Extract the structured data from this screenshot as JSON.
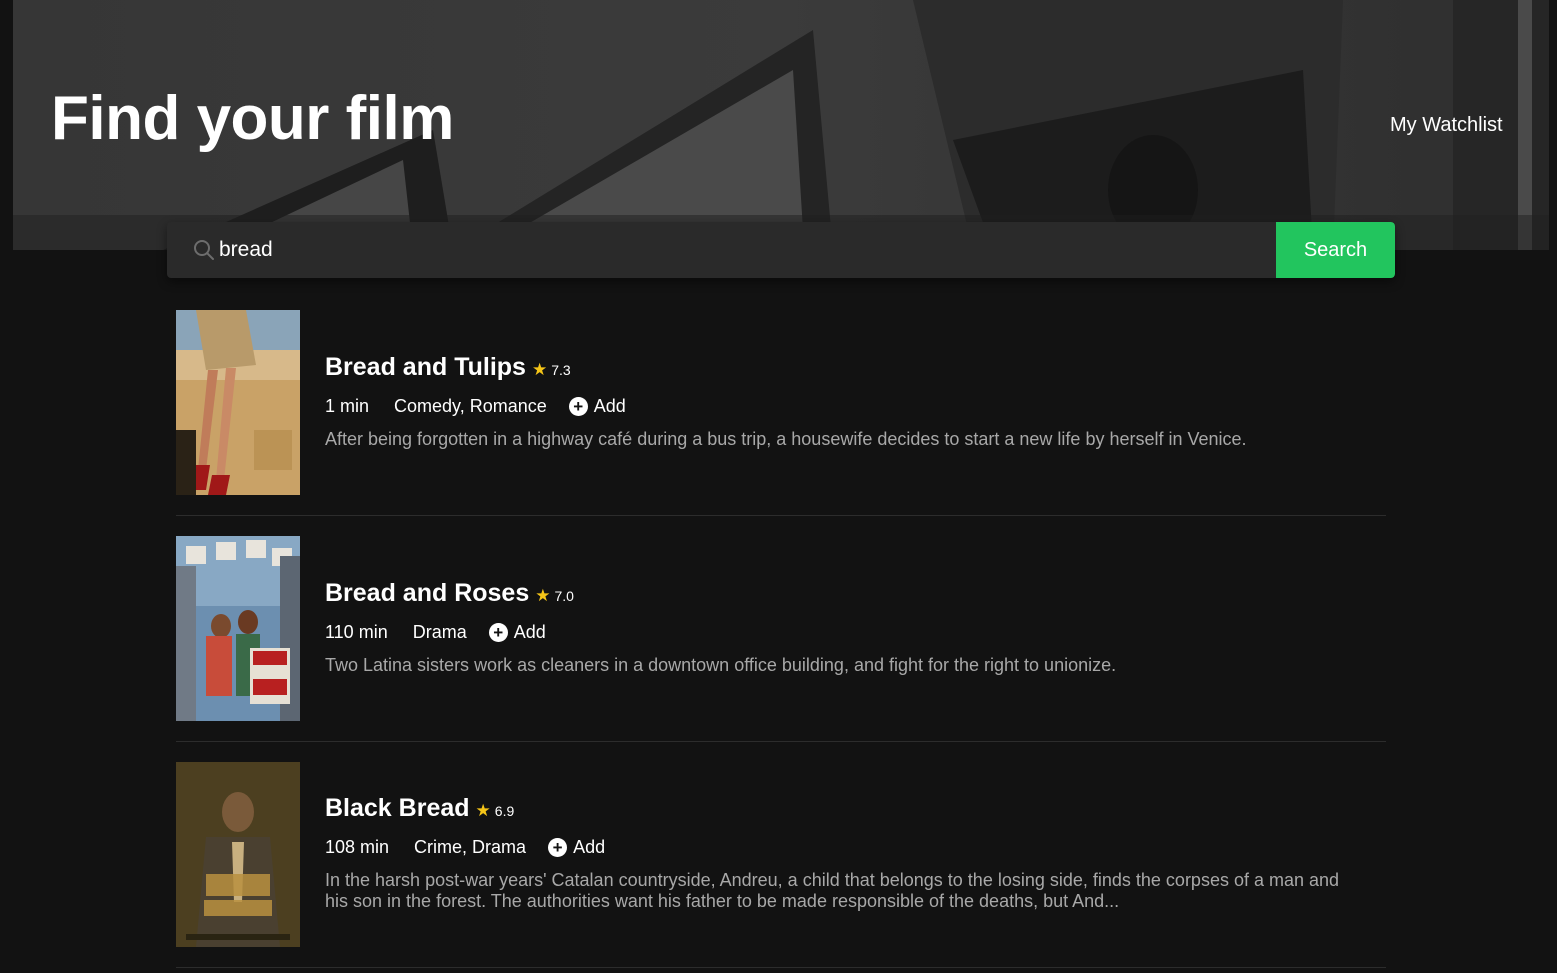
{
  "header": {
    "title": "Find your film",
    "watchlist_label": "My Watchlist"
  },
  "search": {
    "value": "bread",
    "placeholder": "",
    "button_label": "Search"
  },
  "colors": {
    "background": "#121212",
    "accent": "#22c55e",
    "star": "#f5c518",
    "plot_text": "#a8a8a8"
  },
  "results": [
    {
      "title": "Bread and Tulips",
      "rating": "7.3",
      "runtime": "1 min",
      "genres": "Comedy, Romance",
      "add_label": "Add",
      "plot": "After being forgotten in a highway café during a bus trip, a housewife decides to start a new life by herself in Venice."
    },
    {
      "title": "Bread and Roses",
      "rating": "7.0",
      "runtime": "110 min",
      "genres": "Drama",
      "add_label": "Add",
      "plot": "Two Latina sisters work as cleaners in a downtown office building, and fight for the right to unionize."
    },
    {
      "title": "Black Bread",
      "rating": "6.9",
      "runtime": "108 min",
      "genres": "Crime, Drama",
      "add_label": "Add",
      "plot": "In the harsh post-war years' Catalan countryside, Andreu, a child that belongs to the losing side, finds the corpses of a man and his son in the forest. The authorities want his father to be made responsible of the deaths, but And..."
    }
  ]
}
